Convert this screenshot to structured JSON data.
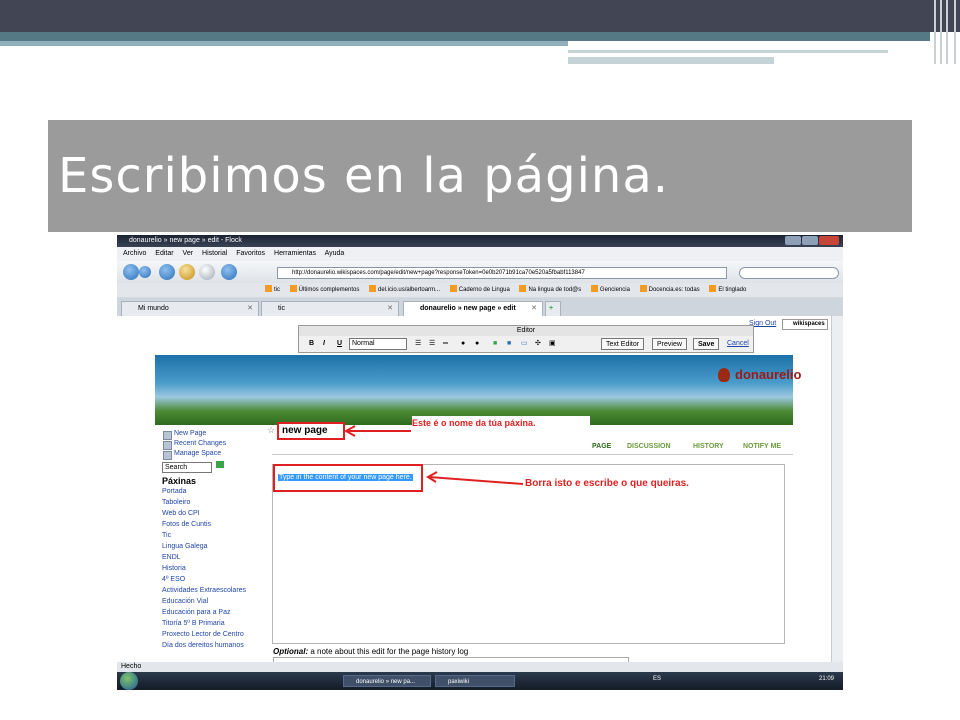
{
  "slide": {
    "title": "Escribimos en la página."
  },
  "browser": {
    "window_title": "donaurelio » new page » edit - Flock",
    "menu": [
      "Archivo",
      "Editar",
      "Ver",
      "Historial",
      "Favoritos",
      "Herramientas",
      "Ayuda"
    ],
    "url": "http://donaurelio.wikispaces.com/page/edit/new+page?responseToken=0e0b2071b91ca70e520a5fbabf113847",
    "bookmarks": [
      "tic",
      "Últimos complementos",
      "del.icio.us/albertoarm...",
      "Caderno de Lingua",
      "Na lingua de tod@s",
      "Genciencia",
      "Docencia.es: todas",
      "El tinglado"
    ],
    "tabs": [
      {
        "label": "Mi mundo"
      },
      {
        "label": "tic"
      },
      {
        "label": "donaurelio » new page » edit"
      }
    ],
    "status": "Hecho"
  },
  "editor": {
    "title": "Editor",
    "bold": "B",
    "italic": "I",
    "underline": "U",
    "format_value": "Normal",
    "text_editor_label": "Text Editor",
    "preview_label": "Preview",
    "save_label": "Save",
    "cancel_label": "Cancel"
  },
  "wiki": {
    "sign_out": "Sign Out",
    "brand": "wikispaces",
    "site_name": "donaurelio",
    "page_name": "new page",
    "actions": [
      "New Page",
      "Recent Changes",
      "Manage Space"
    ],
    "search_value": "Search",
    "nav_heading": "Páxinas",
    "nav_links": [
      "Portada",
      "Taboleiro",
      "Web do CPI",
      "Fotos de Cuntis",
      "Tic",
      "Lingua Galega",
      "ENDL",
      "Historia",
      "4º ESO",
      "Actividades Extraescolares",
      "Educación Vial",
      "Educación para a Paz",
      "Titoría 5º B Primaria",
      "Proxecto Lector de Centro",
      "Día dos dereitos humanos"
    ],
    "page_tabs": [
      "PAGE",
      "DISCUSSION",
      "HISTORY",
      "NOTIFY ME"
    ],
    "placeholder": "Type in the content of your new page here.",
    "note_optional": "Optional:",
    "note_rest": " a note about this edit for the page history log"
  },
  "annotations": {
    "page_name_hint": "Este é o nome da túa páxina.",
    "content_hint": "Borra isto e escribe o que queiras."
  },
  "taskbar": {
    "items": [
      "donaurelio » new pa...",
      "paxiwiki"
    ],
    "language": "ES",
    "clock": "21:09"
  }
}
